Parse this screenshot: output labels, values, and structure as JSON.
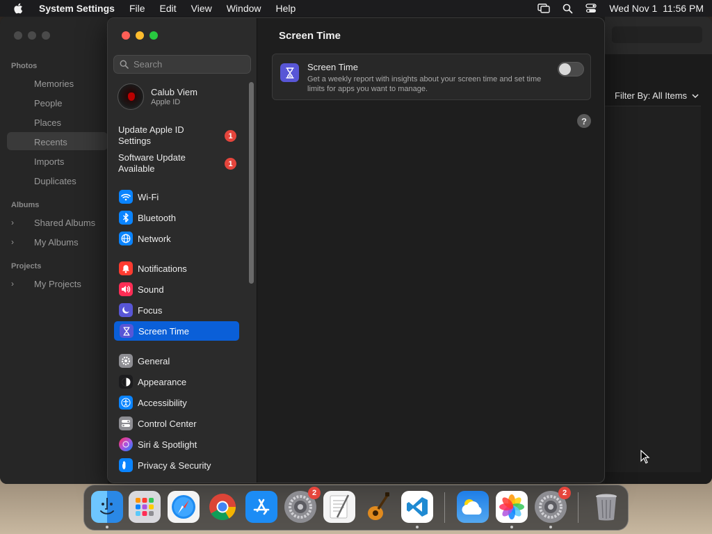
{
  "menubar": {
    "app_name": "System Settings",
    "items": [
      "File",
      "Edit",
      "View",
      "Window",
      "Help"
    ],
    "clock": "Wed Nov 1  11:56 PM"
  },
  "photos": {
    "sections": [
      {
        "label": "Photos",
        "items": [
          "Memories",
          "People",
          "Places",
          "Recents",
          "Imports",
          "Duplicates"
        ]
      },
      {
        "label": "Albums",
        "items": [
          "Shared Albums",
          "My Albums"
        ]
      },
      {
        "label": "Projects",
        "items": [
          "My Projects"
        ]
      }
    ],
    "selected": "Recents",
    "filter": "Filter By: All Items"
  },
  "settings": {
    "search": {
      "placeholder": "Search"
    },
    "account": {
      "name": "Calub Viem",
      "subtitle": "Apple ID"
    },
    "notices": [
      {
        "label": "Update Apple ID Settings",
        "badge": "1"
      },
      {
        "label": "Software Update Available",
        "badge": "1"
      }
    ],
    "nav": [
      {
        "label": "Wi-Fi",
        "icon": "wifi-icon",
        "color": "#0a84ff"
      },
      {
        "label": "Bluetooth",
        "icon": "bluetooth-icon",
        "color": "#0a84ff"
      },
      {
        "label": "Network",
        "icon": "globe-icon",
        "color": "#0a84ff"
      },
      {
        "label": "Notifications",
        "icon": "bell-icon",
        "color": "#ff3b30"
      },
      {
        "label": "Sound",
        "icon": "speaker-icon",
        "color": "#ff2d55"
      },
      {
        "label": "Focus",
        "icon": "moon-icon",
        "color": "#5856d6"
      },
      {
        "label": "Screen Time",
        "icon": "hourglass-icon",
        "color": "#5856d6"
      },
      {
        "label": "General",
        "icon": "gear-icon",
        "color": "#8e8e93"
      },
      {
        "label": "Appearance",
        "icon": "appearance-icon",
        "color": "#1c1c1e"
      },
      {
        "label": "Accessibility",
        "icon": "accessibility-icon",
        "color": "#0a84ff"
      },
      {
        "label": "Control Center",
        "icon": "control-center-icon",
        "color": "#8e8e93"
      },
      {
        "label": "Siri & Spotlight",
        "icon": "siri-icon",
        "color": "#af52de"
      },
      {
        "label": "Privacy & Security",
        "icon": "hand-icon",
        "color": "#0a84ff"
      }
    ],
    "selected": "Screen Time",
    "pane": {
      "title": "Screen Time",
      "card_title": "Screen Time",
      "card_description": "Get a weekly report with insights about your screen time and set time limits for apps you want to manage.",
      "toggle_on": false,
      "help": "?"
    }
  },
  "dock": {
    "apps": [
      {
        "name": "Finder",
        "icon": "finder-icon",
        "running": true
      },
      {
        "name": "Launchpad",
        "icon": "launchpad-icon",
        "running": false
      },
      {
        "name": "Safari",
        "icon": "safari-icon",
        "running": false
      },
      {
        "name": "Chrome",
        "icon": "chrome-icon",
        "running": false
      },
      {
        "name": "App Store",
        "icon": "app-store-icon",
        "running": false
      },
      {
        "name": "System Settings",
        "icon": "system-settings-icon",
        "running": false,
        "badge": "2"
      },
      {
        "name": "TextEdit",
        "icon": "textedit-icon",
        "running": false
      },
      {
        "name": "GarageBand",
        "icon": "garageband-icon",
        "running": false
      },
      {
        "name": "Visual Studio Code",
        "icon": "vscode-icon",
        "running": true
      },
      {
        "name": "Weather",
        "icon": "weather-icon",
        "running": false
      },
      {
        "name": "Photos",
        "icon": "photos-icon",
        "running": true
      },
      {
        "name": "System Settings",
        "icon": "system-settings-icon",
        "running": true,
        "badge": "2"
      },
      {
        "name": "Trash",
        "icon": "trash-icon",
        "running": false
      }
    ]
  }
}
